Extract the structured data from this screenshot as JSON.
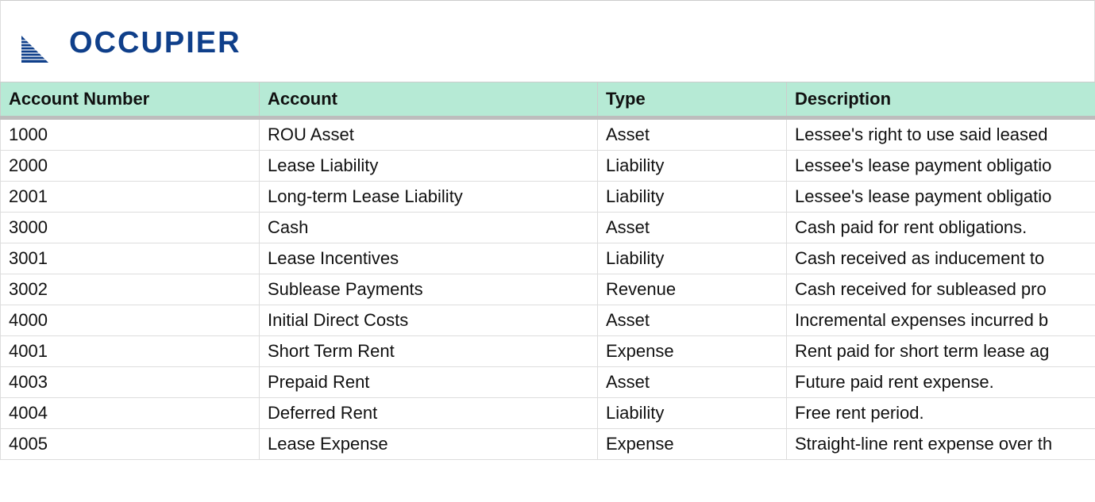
{
  "brand": "OCCUPIER",
  "table": {
    "headers": {
      "account_number": "Account Number",
      "account": "Account",
      "type": "Type",
      "description": "Description"
    },
    "rows": [
      {
        "number": "1000",
        "account": "ROU Asset",
        "type": "Asset",
        "description": "Lessee's right to use said leased"
      },
      {
        "number": "2000",
        "account": "Lease Liability",
        "type": "Liability",
        "description": "Lessee's lease payment obligatio"
      },
      {
        "number": "2001",
        "account": "Long-term Lease Liability",
        "type": "Liability",
        "description": "Lessee's lease payment obligatio"
      },
      {
        "number": "3000",
        "account": "Cash",
        "type": "Asset",
        "description": "Cash paid for rent obligations."
      },
      {
        "number": "3001",
        "account": "Lease Incentives",
        "type": "Liability",
        "description": "Cash received as inducement to"
      },
      {
        "number": "3002",
        "account": "Sublease Payments",
        "type": "Revenue",
        "description": "Cash received for subleased pro"
      },
      {
        "number": "4000",
        "account": "Initial Direct Costs",
        "type": "Asset",
        "description": "Incremental expenses incurred b"
      },
      {
        "number": "4001",
        "account": "Short Term Rent",
        "type": "Expense",
        "description": "Rent paid for short term lease ag"
      },
      {
        "number": "4003",
        "account": "Prepaid Rent",
        "type": "Asset",
        "description": "Future paid rent expense."
      },
      {
        "number": "4004",
        "account": "Deferred Rent",
        "type": "Liability",
        "description": "Free rent period."
      },
      {
        "number": "4005",
        "account": "Lease Expense",
        "type": "Expense",
        "description": "Straight-line rent expense over th"
      }
    ]
  }
}
